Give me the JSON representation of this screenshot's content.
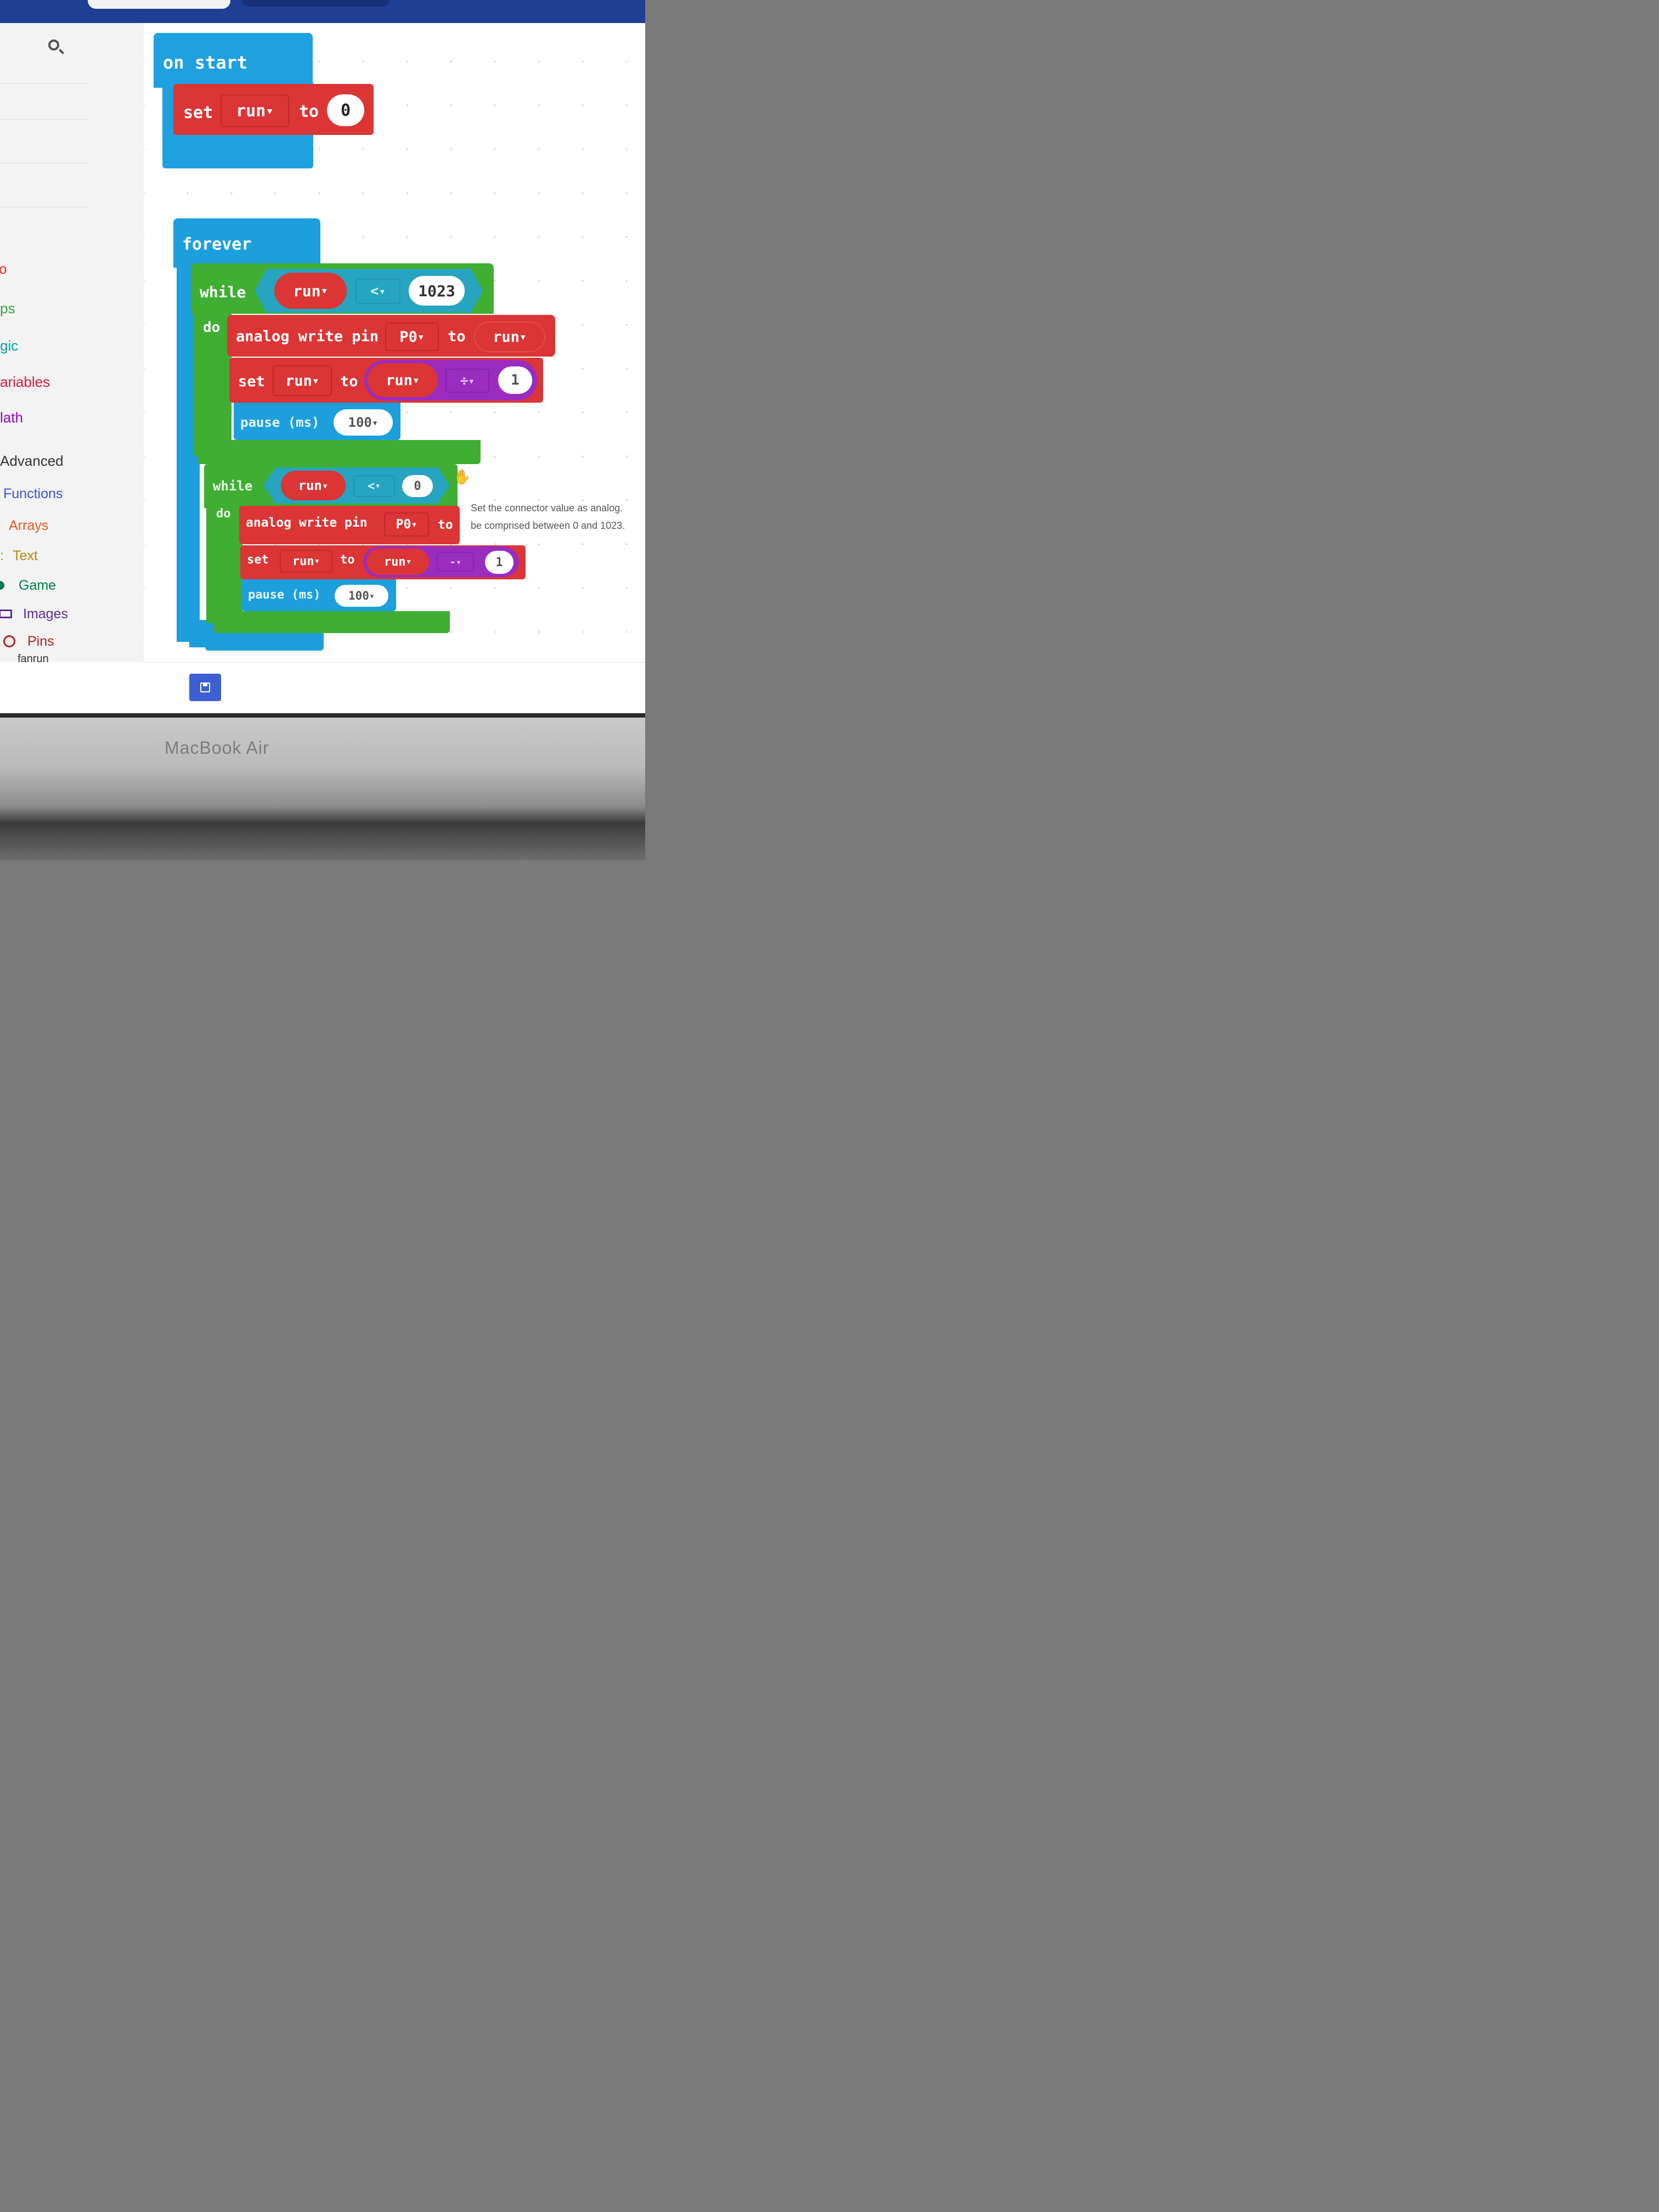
{
  "toolbox": {
    "items": [
      {
        "label": "o",
        "color": "#e63022"
      },
      {
        "label": "ps",
        "color": "#3aa33a"
      },
      {
        "label": "gic",
        "color": "#00a4a6"
      },
      {
        "label": "ariables",
        "color": "#dc143c"
      },
      {
        "label": "lath",
        "color": "#9400d3"
      },
      {
        "label": "Advanced",
        "color": "#333333"
      },
      {
        "label": "Functions",
        "color": "#3455db"
      },
      {
        "label": "Arrays",
        "color": "#e65722"
      },
      {
        "label": "Text",
        "color": "#b8860b"
      },
      {
        "label": "Game",
        "color": "#007a4b"
      },
      {
        "label": "Images",
        "color": "#5c2d91"
      },
      {
        "label": "Pins",
        "color": "#b22222"
      }
    ],
    "project_name": "fanrun"
  },
  "on_start": {
    "hat": "on start",
    "set": "set",
    "var": "run",
    "to": "to",
    "value": "0"
  },
  "forever": {
    "hat": "forever",
    "loop1": {
      "while": "while",
      "var": "run",
      "op": "<",
      "limit": "1023",
      "do": "do",
      "write_label": "analog write pin",
      "pin": "P0",
      "to": "to",
      "write_var": "run",
      "set": "set",
      "set_var": "run",
      "set_to": "to",
      "expr_var": "run",
      "expr_op": "÷",
      "expr_num": "1",
      "pause": "pause (ms)",
      "pause_val": "100"
    },
    "loop2": {
      "while": "while",
      "var": "run",
      "op": "<",
      "limit": "0",
      "do": "do",
      "write_label": "analog write pin",
      "pin": "P0",
      "to": "to",
      "set": "set",
      "set_var": "run",
      "set_to": "to",
      "expr_var": "run",
      "expr_op": "-",
      "expr_num": "1",
      "pause": "pause (ms)",
      "pause_val": "100"
    }
  },
  "tooltip": {
    "line1": "Set the connector value as analog.",
    "line2": "be comprised between 0 and 1023."
  },
  "laptop": {
    "brand": "MacBook Air"
  }
}
